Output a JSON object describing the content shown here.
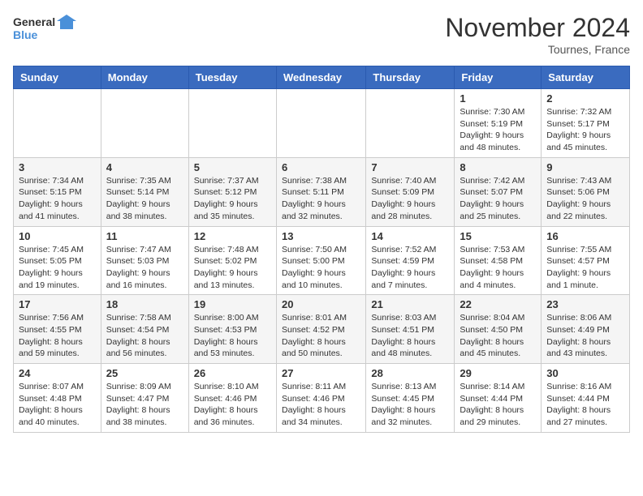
{
  "app": {
    "name1": "General",
    "name2": "Blue"
  },
  "title": "November 2024",
  "location": "Tournes, France",
  "days_of_week": [
    "Sunday",
    "Monday",
    "Tuesday",
    "Wednesday",
    "Thursday",
    "Friday",
    "Saturday"
  ],
  "weeks": [
    [
      {
        "day": "",
        "info": ""
      },
      {
        "day": "",
        "info": ""
      },
      {
        "day": "",
        "info": ""
      },
      {
        "day": "",
        "info": ""
      },
      {
        "day": "",
        "info": ""
      },
      {
        "day": "1",
        "info": "Sunrise: 7:30 AM\nSunset: 5:19 PM\nDaylight: 9 hours and 48 minutes."
      },
      {
        "day": "2",
        "info": "Sunrise: 7:32 AM\nSunset: 5:17 PM\nDaylight: 9 hours and 45 minutes."
      }
    ],
    [
      {
        "day": "3",
        "info": "Sunrise: 7:34 AM\nSunset: 5:15 PM\nDaylight: 9 hours and 41 minutes."
      },
      {
        "day": "4",
        "info": "Sunrise: 7:35 AM\nSunset: 5:14 PM\nDaylight: 9 hours and 38 minutes."
      },
      {
        "day": "5",
        "info": "Sunrise: 7:37 AM\nSunset: 5:12 PM\nDaylight: 9 hours and 35 minutes."
      },
      {
        "day": "6",
        "info": "Sunrise: 7:38 AM\nSunset: 5:11 PM\nDaylight: 9 hours and 32 minutes."
      },
      {
        "day": "7",
        "info": "Sunrise: 7:40 AM\nSunset: 5:09 PM\nDaylight: 9 hours and 28 minutes."
      },
      {
        "day": "8",
        "info": "Sunrise: 7:42 AM\nSunset: 5:07 PM\nDaylight: 9 hours and 25 minutes."
      },
      {
        "day": "9",
        "info": "Sunrise: 7:43 AM\nSunset: 5:06 PM\nDaylight: 9 hours and 22 minutes."
      }
    ],
    [
      {
        "day": "10",
        "info": "Sunrise: 7:45 AM\nSunset: 5:05 PM\nDaylight: 9 hours and 19 minutes."
      },
      {
        "day": "11",
        "info": "Sunrise: 7:47 AM\nSunset: 5:03 PM\nDaylight: 9 hours and 16 minutes."
      },
      {
        "day": "12",
        "info": "Sunrise: 7:48 AM\nSunset: 5:02 PM\nDaylight: 9 hours and 13 minutes."
      },
      {
        "day": "13",
        "info": "Sunrise: 7:50 AM\nSunset: 5:00 PM\nDaylight: 9 hours and 10 minutes."
      },
      {
        "day": "14",
        "info": "Sunrise: 7:52 AM\nSunset: 4:59 PM\nDaylight: 9 hours and 7 minutes."
      },
      {
        "day": "15",
        "info": "Sunrise: 7:53 AM\nSunset: 4:58 PM\nDaylight: 9 hours and 4 minutes."
      },
      {
        "day": "16",
        "info": "Sunrise: 7:55 AM\nSunset: 4:57 PM\nDaylight: 9 hours and 1 minute."
      }
    ],
    [
      {
        "day": "17",
        "info": "Sunrise: 7:56 AM\nSunset: 4:55 PM\nDaylight: 8 hours and 59 minutes."
      },
      {
        "day": "18",
        "info": "Sunrise: 7:58 AM\nSunset: 4:54 PM\nDaylight: 8 hours and 56 minutes."
      },
      {
        "day": "19",
        "info": "Sunrise: 8:00 AM\nSunset: 4:53 PM\nDaylight: 8 hours and 53 minutes."
      },
      {
        "day": "20",
        "info": "Sunrise: 8:01 AM\nSunset: 4:52 PM\nDaylight: 8 hours and 50 minutes."
      },
      {
        "day": "21",
        "info": "Sunrise: 8:03 AM\nSunset: 4:51 PM\nDaylight: 8 hours and 48 minutes."
      },
      {
        "day": "22",
        "info": "Sunrise: 8:04 AM\nSunset: 4:50 PM\nDaylight: 8 hours and 45 minutes."
      },
      {
        "day": "23",
        "info": "Sunrise: 8:06 AM\nSunset: 4:49 PM\nDaylight: 8 hours and 43 minutes."
      }
    ],
    [
      {
        "day": "24",
        "info": "Sunrise: 8:07 AM\nSunset: 4:48 PM\nDaylight: 8 hours and 40 minutes."
      },
      {
        "day": "25",
        "info": "Sunrise: 8:09 AM\nSunset: 4:47 PM\nDaylight: 8 hours and 38 minutes."
      },
      {
        "day": "26",
        "info": "Sunrise: 8:10 AM\nSunset: 4:46 PM\nDaylight: 8 hours and 36 minutes."
      },
      {
        "day": "27",
        "info": "Sunrise: 8:11 AM\nSunset: 4:46 PM\nDaylight: 8 hours and 34 minutes."
      },
      {
        "day": "28",
        "info": "Sunrise: 8:13 AM\nSunset: 4:45 PM\nDaylight: 8 hours and 32 minutes."
      },
      {
        "day": "29",
        "info": "Sunrise: 8:14 AM\nSunset: 4:44 PM\nDaylight: 8 hours and 29 minutes."
      },
      {
        "day": "30",
        "info": "Sunrise: 8:16 AM\nSunset: 4:44 PM\nDaylight: 8 hours and 27 minutes."
      }
    ]
  ]
}
